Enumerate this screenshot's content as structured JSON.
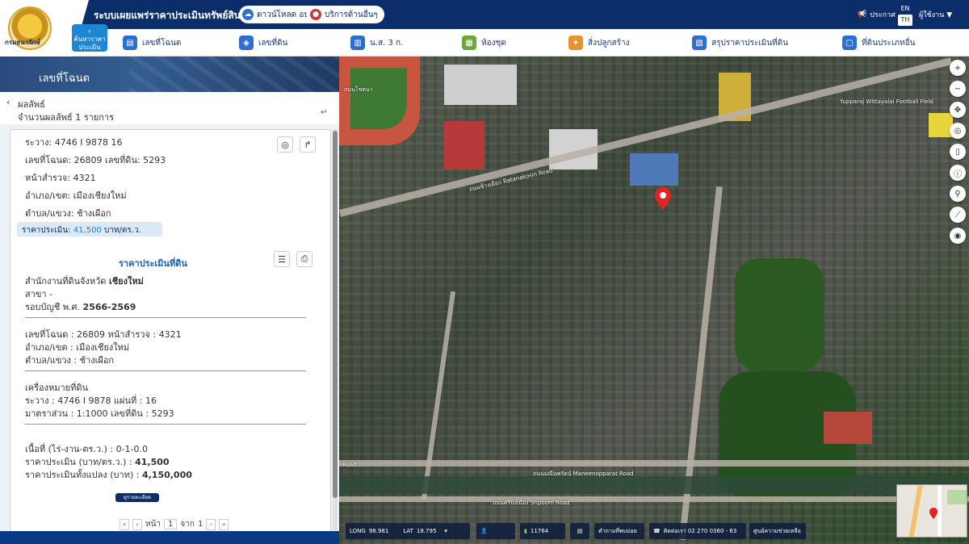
{
  "header": {
    "logo_text": "กรมธนารักษ์",
    "title": "ระบบเผยแพร่ราคาประเมินทรัพย์สิน",
    "download_btn": "ดาวน์โหลด อปท.",
    "services_btn": "บริการด้านอื่นๆ",
    "announce": "ประกาศ",
    "lang_en": "EN",
    "lang_th": "TH",
    "user": "ผู้ใช้งาน"
  },
  "menu": {
    "search_chip": "ค้นหาราคาประเมิน",
    "items": [
      {
        "label": "เลขที่โฉนด",
        "color": "#2d6fd0"
      },
      {
        "label": "เลขที่ดิน",
        "color": "#2d6fd0"
      },
      {
        "label": "น.ส. 3 ก.",
        "color": "#2d6fd0"
      },
      {
        "label": "ห้องชุด",
        "color": "#6aa83a"
      },
      {
        "label": "สิ่งปลูกสร้าง",
        "color": "#e9922b"
      },
      {
        "label": "สรุปราคาประเมินที่ดิน",
        "color": "#2d6fd0"
      },
      {
        "label": "ที่ดินประเภทอื่น",
        "color": "#2d6fd0"
      }
    ]
  },
  "panel": {
    "banner_title": "เลขที่โฉนด",
    "results_title": "ผลลัพธ์",
    "results_count": "จำนวนผลลัพธ์ 1 รายการ",
    "collapse_icon": "↵"
  },
  "card": {
    "rawang": "ระวาง: 4746 I 9878 16",
    "deed_land": "เลขที่โฉนด: 26809 เลขที่ดิน: 5293",
    "survey_page": "หน้าสำรวจ: 4321",
    "district": "อำเภอ/เขต: เมืองเชียงใหม่",
    "subdistrict": "ตำบล/แขวง: ช้างเผือก",
    "price_label": "ราคาประเมิน:",
    "price_value": "41,500",
    "price_unit": "บาท/ตร.ว.",
    "section_title": "ราคาประเมินที่ดิน",
    "office_prefix": "สำนักงานที่ดินจังหวัด",
    "office_province": "เชียงใหม่",
    "branch": "สาขา -",
    "account_prefix": "รอบบัญชี พ.ศ.",
    "account_years": "2566-2569",
    "deed_detail": "เลขที่โฉนด : 26809 หน้าสำรวจ : 4321",
    "district_detail": "อำเภอ/เขต : เมืองเชียงใหม่",
    "subdistrict_detail": "ตำบล/แขวง : ช้างเผือก",
    "marker_title": "เครื่องหมายที่ดิน",
    "rawang_detail": "ระวาง : 4746 I 9878 แผ่นที่ : 16",
    "scale_detail": "มาตราส่วน : 1:1000 เลขที่ดิน : 5293",
    "area_detail": "เนื้อที่ (ไร่-งาน-ตร.ว.) : 0-1-0.0",
    "price_sqw_prefix": "ราคาประเมิน (บาท/ตร.ว.) :",
    "price_sqw": "41,500",
    "price_total_prefix": "ราคาประเมินทั้งแปลง (บาท) :",
    "price_total": "4,150,000",
    "detail_btn": "ดูรายละเอียด"
  },
  "pager": {
    "page_label": "หน้า",
    "page": "1",
    "of_label": "จาก",
    "total": "1"
  },
  "map": {
    "labels": [
      "ถนนโชตนา",
      "ถนนช้างเผือก Ratanakosin Road",
      "Yupparaj Wittayalai Football Field",
      "ถนนศรีปิงเมือง Sripoom Road",
      "ถนนมณีนพรัตน์ Maneenopparat Road",
      "Road"
    ],
    "status": {
      "long_label": "LONG",
      "long": "98.981",
      "lat_label": "LAT",
      "lat": "18.795",
      "visitors": "11764",
      "contact_site": "คำถามที่พบบ่อย",
      "contact_phone": "ติดต่อเรา 02 270 0360 - 63",
      "help": "ศูนย์ความช่วยเหลือ"
    }
  }
}
